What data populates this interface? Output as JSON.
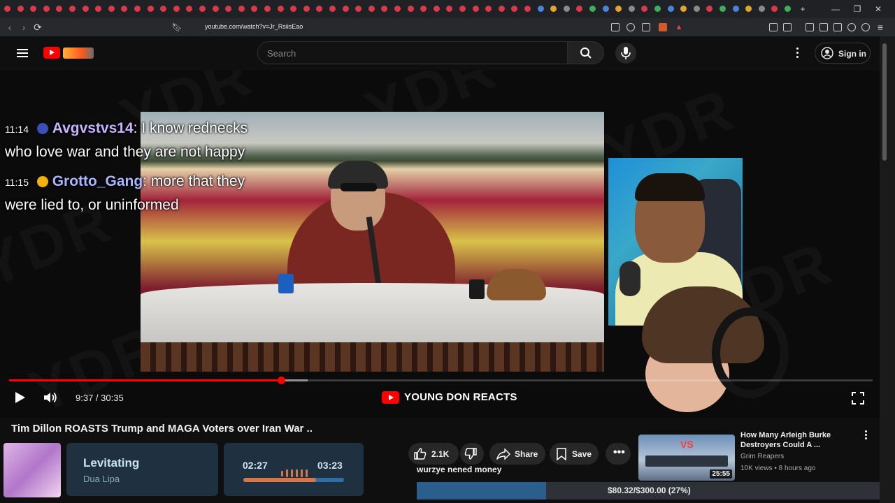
{
  "browser": {
    "url": "youtube.com/watch?v=Jr_RsiisEao",
    "window_controls": [
      "—",
      "❐",
      "✕"
    ],
    "new_tab": "+"
  },
  "youtube": {
    "search_placeholder": "Search",
    "sign_in_label": "Sign in"
  },
  "player": {
    "chat": [
      {
        "time": "11:14",
        "user": "Avgvstvs14",
        "message_line1": "I know rednecks",
        "message_line2": "who love war and they are not happy"
      },
      {
        "time": "11:15",
        "user": "Grotto_Gang",
        "message_line1": "more that they",
        "message_line2": "were lied to, or uninformed"
      }
    ],
    "time_display": "9:37 / 30:35",
    "progress_fraction": 0.315,
    "channel_brand": "YOUNG DON REACTS"
  },
  "video": {
    "title": "Tim Dillon ROASTS Trump and MAGA Voters over Iran War ..",
    "likes": "2.1K",
    "share_label": "Share",
    "save_label": "Save"
  },
  "overlays": {
    "music": {
      "title": "Levitating",
      "artist": "Dua Lipa"
    },
    "timer": {
      "elapsed": "02:27",
      "total": "03:23",
      "progress_fraction": 0.72
    },
    "donor_text": "wurzye nened money",
    "goal_text": "$80.32/$300.00 (27%)",
    "goal_fraction": 0.27
  },
  "recommendation": {
    "title": "How Many Arleigh Burke Destroyers Could A ...",
    "channel": "Grim Reapers",
    "meta": "10K views • 8 hours ago",
    "duration": "25:55",
    "thumb_text": "VS"
  },
  "colors": {
    "accent": "#ff0000",
    "chat_user1": "#c9b2ff",
    "chat_user2": "#a8b5ff",
    "overlay_bg": "#1f3140"
  }
}
